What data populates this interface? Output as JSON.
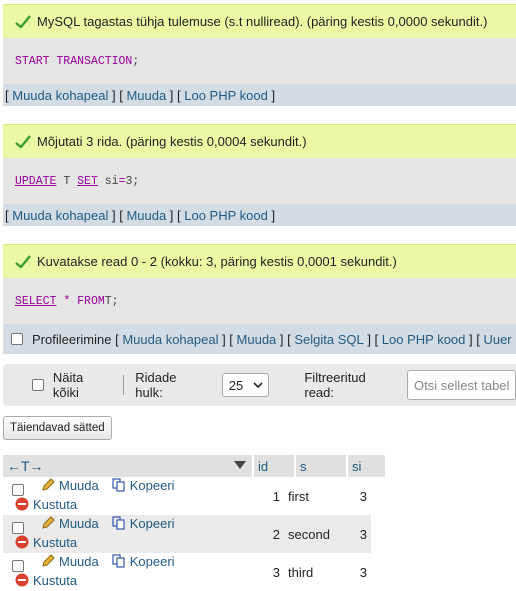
{
  "messages": [
    {
      "text": "MySQL tagastas tühja tulemuse (s.t nulliread). (päring kestis 0,0000 sekundit.)"
    },
    {
      "text": "Mõjutati 3 rida. (päring kestis 0,0004 sekundit.)"
    },
    {
      "text": "Kuvatakse read 0 - 2 (kokku: 3, päring kestis 0,0001 sekundit.)"
    }
  ],
  "queries": {
    "q1": {
      "kw1": "START TRANSACTION",
      "rest": ";"
    },
    "q2": {
      "kw1": "UPDATE",
      "mid1": " T ",
      "kw2": "SET",
      "mid2": " si",
      "op": "=",
      "end": "3;"
    },
    "q3": {
      "kw1": "SELECT",
      "star": "*",
      "kw2": "FROM",
      "end": " T;"
    }
  },
  "links": {
    "edit_inline": "Muuda kohapeal",
    "edit": "Muuda",
    "create_php": "Loo PHP kood",
    "explain": "Selgita SQL",
    "profiling": "Profileerimine",
    "refresh": "Uuer"
  },
  "toolbar": {
    "show_all": "Näita kõiki",
    "row_count_label": "Ridade hulk:",
    "row_count_value": "25",
    "filter_label": "Filtreeritud read:",
    "filter_placeholder": "Otsi sellest tabel"
  },
  "options_button": "Täiendavad sätted",
  "table": {
    "columns": [
      "id",
      "s",
      "si"
    ],
    "actions": {
      "edit": "Muuda",
      "copy": "Kopeeri",
      "delete": "Kustuta"
    },
    "rows": [
      {
        "id": "1",
        "s": "first",
        "si": "3"
      },
      {
        "id": "2",
        "s": "second",
        "si": "3"
      },
      {
        "id": "3",
        "s": "third",
        "si": "3"
      }
    ]
  },
  "colors": {
    "success_bg": "#ebf8a4",
    "sql_bg": "#e5e5e5",
    "link": "#235a81",
    "keyword": "#990099"
  }
}
